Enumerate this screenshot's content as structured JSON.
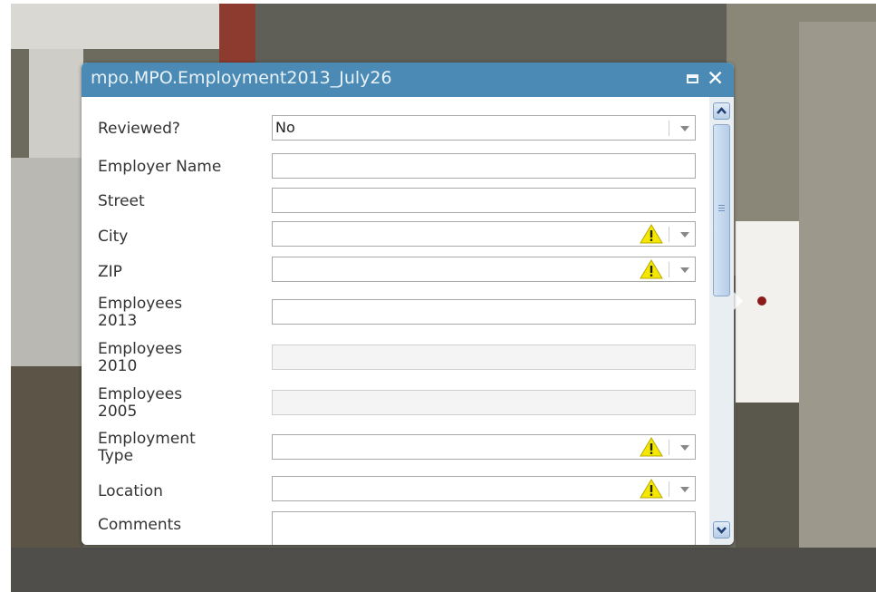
{
  "popup": {
    "title": "mpo.MPO.Employment2013_July26",
    "fields": [
      {
        "label": "Reviewed?",
        "value": "No",
        "type": "dropdown",
        "warning": false
      },
      {
        "label": "Employer Name",
        "value": "",
        "type": "text"
      },
      {
        "label": "Street",
        "value": "",
        "type": "text"
      },
      {
        "label": "City",
        "value": "",
        "type": "dropdown",
        "warning": true
      },
      {
        "label": "ZIP",
        "value": "",
        "type": "dropdown",
        "warning": true
      },
      {
        "label": "Employees 2013",
        "value": "",
        "type": "text"
      },
      {
        "label": "Employees 2010",
        "value": "",
        "type": "readonly"
      },
      {
        "label": "Employees 2005",
        "value": "",
        "type": "readonly"
      },
      {
        "label": "Employment Type",
        "value": "",
        "type": "dropdown",
        "warning": true
      },
      {
        "label": "Location",
        "value": "",
        "type": "dropdown",
        "warning": true
      },
      {
        "label": "Comments",
        "value": "",
        "type": "textarea"
      }
    ]
  },
  "icons": {
    "maximize": "maximize-icon",
    "close": "close-icon",
    "warning": "warning-icon",
    "dropdown": "chevron-down-icon",
    "scroll_up": "scroll-up-icon",
    "scroll_down": "scroll-down-icon"
  },
  "colors": {
    "titlebar": "#4a8ab5",
    "warning": "#f5e800",
    "feature_point": "#8b1a1a"
  }
}
